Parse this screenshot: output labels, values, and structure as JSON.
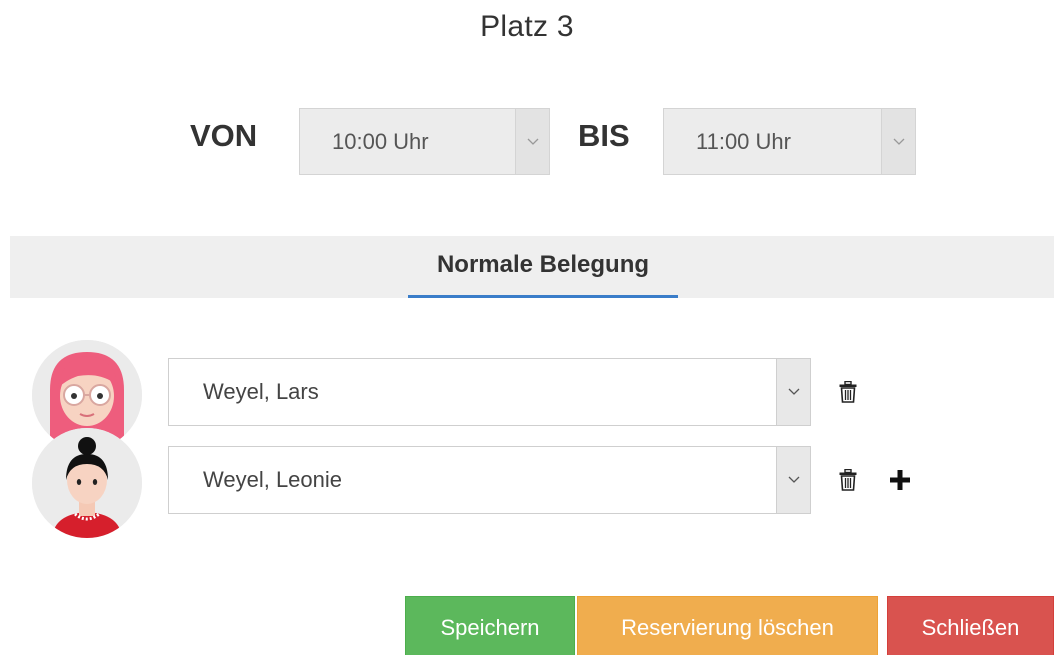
{
  "header": {
    "title": "Platz 3"
  },
  "time": {
    "from_label": "VON",
    "from_value": "10:00 Uhr",
    "to_label": "BIS",
    "to_value": "11:00 Uhr"
  },
  "tabs": [
    {
      "label": "Normale Belegung",
      "active": true
    }
  ],
  "players": [
    {
      "name": "Weyel, Lars",
      "avatar": "red-haired-woman-glasses-avatar"
    },
    {
      "name": "Weyel, Leonie",
      "avatar": "dark-haired-woman-bun-avatar"
    }
  ],
  "icons": {
    "delete": "trash-icon",
    "add": "plus-icon",
    "dropdown": "chevron-down-icon"
  },
  "actions": {
    "save_label": "Speichern",
    "delete_label": "Reservierung löschen",
    "close_label": "Schließen"
  },
  "colors": {
    "accent": "#3a7dc9",
    "save": "#5cb85c",
    "delete": "#f0ad4e",
    "close": "#d9534f"
  }
}
